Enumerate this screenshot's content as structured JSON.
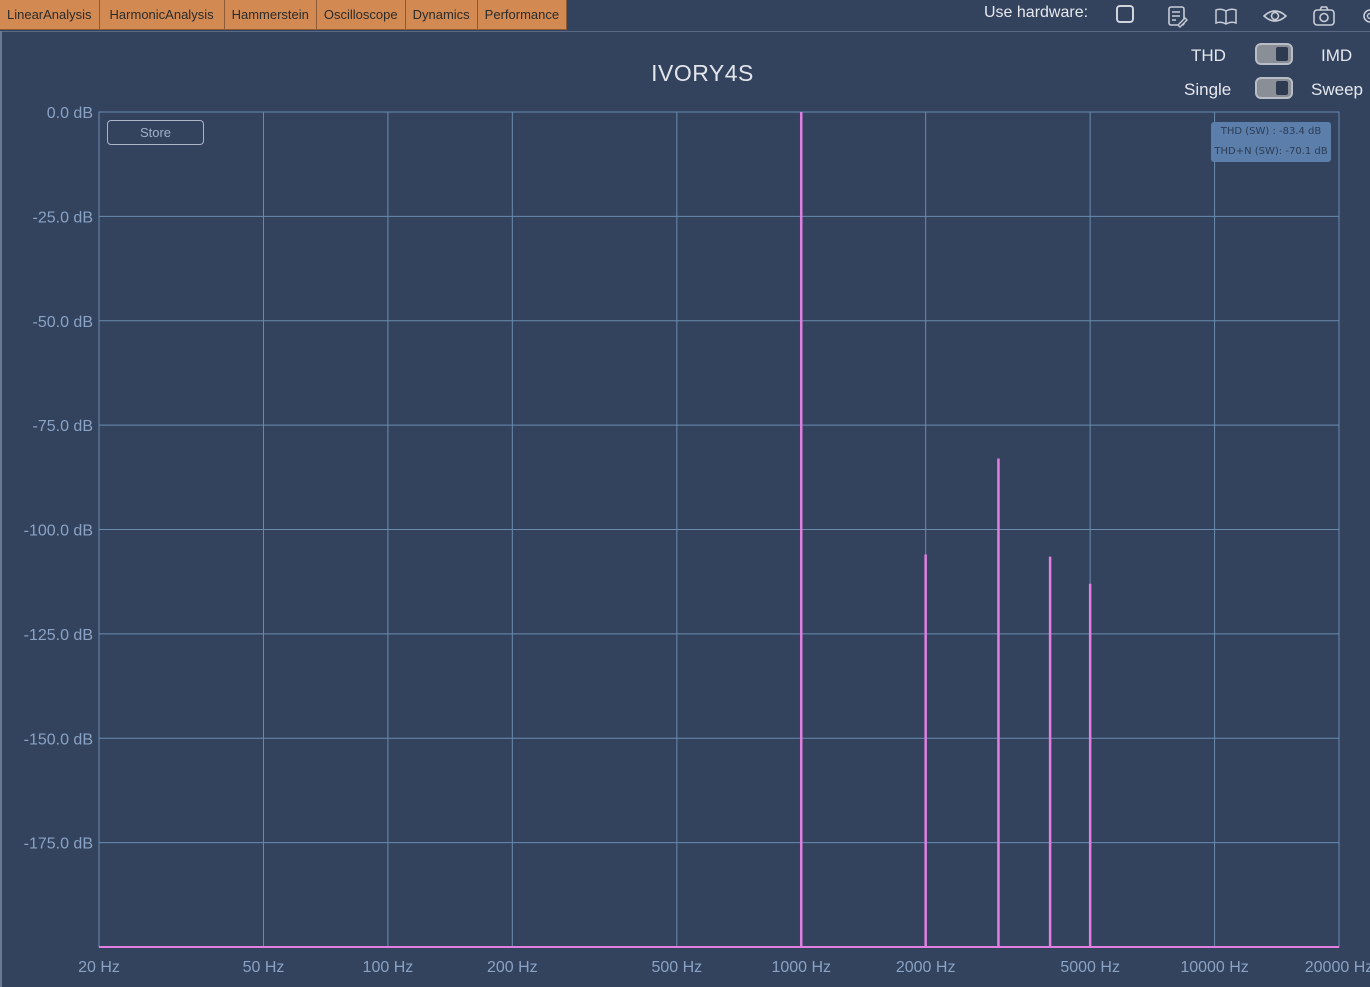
{
  "tabs": [
    {
      "label": "LinearAnalysis"
    },
    {
      "label": "HarmonicAnalysis"
    },
    {
      "label": "Hammerstein"
    },
    {
      "label": "Oscilloscope"
    },
    {
      "label": "Dynamics"
    },
    {
      "label": "Performance"
    }
  ],
  "toolbar": {
    "use_hardware_label": "Use hardware:",
    "use_hardware_checked": false,
    "icons": [
      "edit-notes-icon",
      "book-icon",
      "eye-icon",
      "camera-icon",
      "gear-icon"
    ]
  },
  "title": "IVORY4S",
  "toggles": {
    "mode": {
      "left": "THD",
      "right": "IMD",
      "state": "THD"
    },
    "sweep": {
      "left": "Single",
      "right": "Sweep",
      "state": "Single"
    }
  },
  "store_label": "Store",
  "readout": {
    "thd": "THD (SW) : -83.4 dB",
    "thdn": "THD+N (SW): -70.1 dB"
  },
  "colors": {
    "background": "#33435e",
    "grid": "#6a8bae",
    "trace": "#e07fe0",
    "tab": "#d28a52"
  },
  "chart_data": {
    "type": "bar",
    "xscale": "log",
    "xlim": [
      20,
      20000
    ],
    "ylim": [
      -200,
      0
    ],
    "x_ticks": [
      20,
      50,
      100,
      200,
      500,
      1000,
      2000,
      5000,
      10000,
      20000
    ],
    "x_tick_labels": [
      "20 Hz",
      "50 Hz",
      "100 Hz",
      "200 Hz",
      "500 Hz",
      "1000 Hz",
      "2000 Hz",
      "5000 Hz",
      "10000 Hz",
      "20000 Hz"
    ],
    "y_ticks": [
      0,
      -25,
      -50,
      -75,
      -100,
      -125,
      -150,
      -175
    ],
    "y_tick_labels": [
      "0.0 dB",
      "-25.0 dB",
      "-50.0 dB",
      "-75.0 dB",
      "-100.0 dB",
      "-125.0 dB",
      "-150.0 dB",
      "-175.0 dB"
    ],
    "grid": true,
    "harmonics": [
      {
        "freq": 1000,
        "db": 0
      },
      {
        "freq": 2000,
        "db": -106
      },
      {
        "freq": 3000,
        "db": -83
      },
      {
        "freq": 4000,
        "db": -106.5
      },
      {
        "freq": 5000,
        "db": -113
      }
    ]
  }
}
